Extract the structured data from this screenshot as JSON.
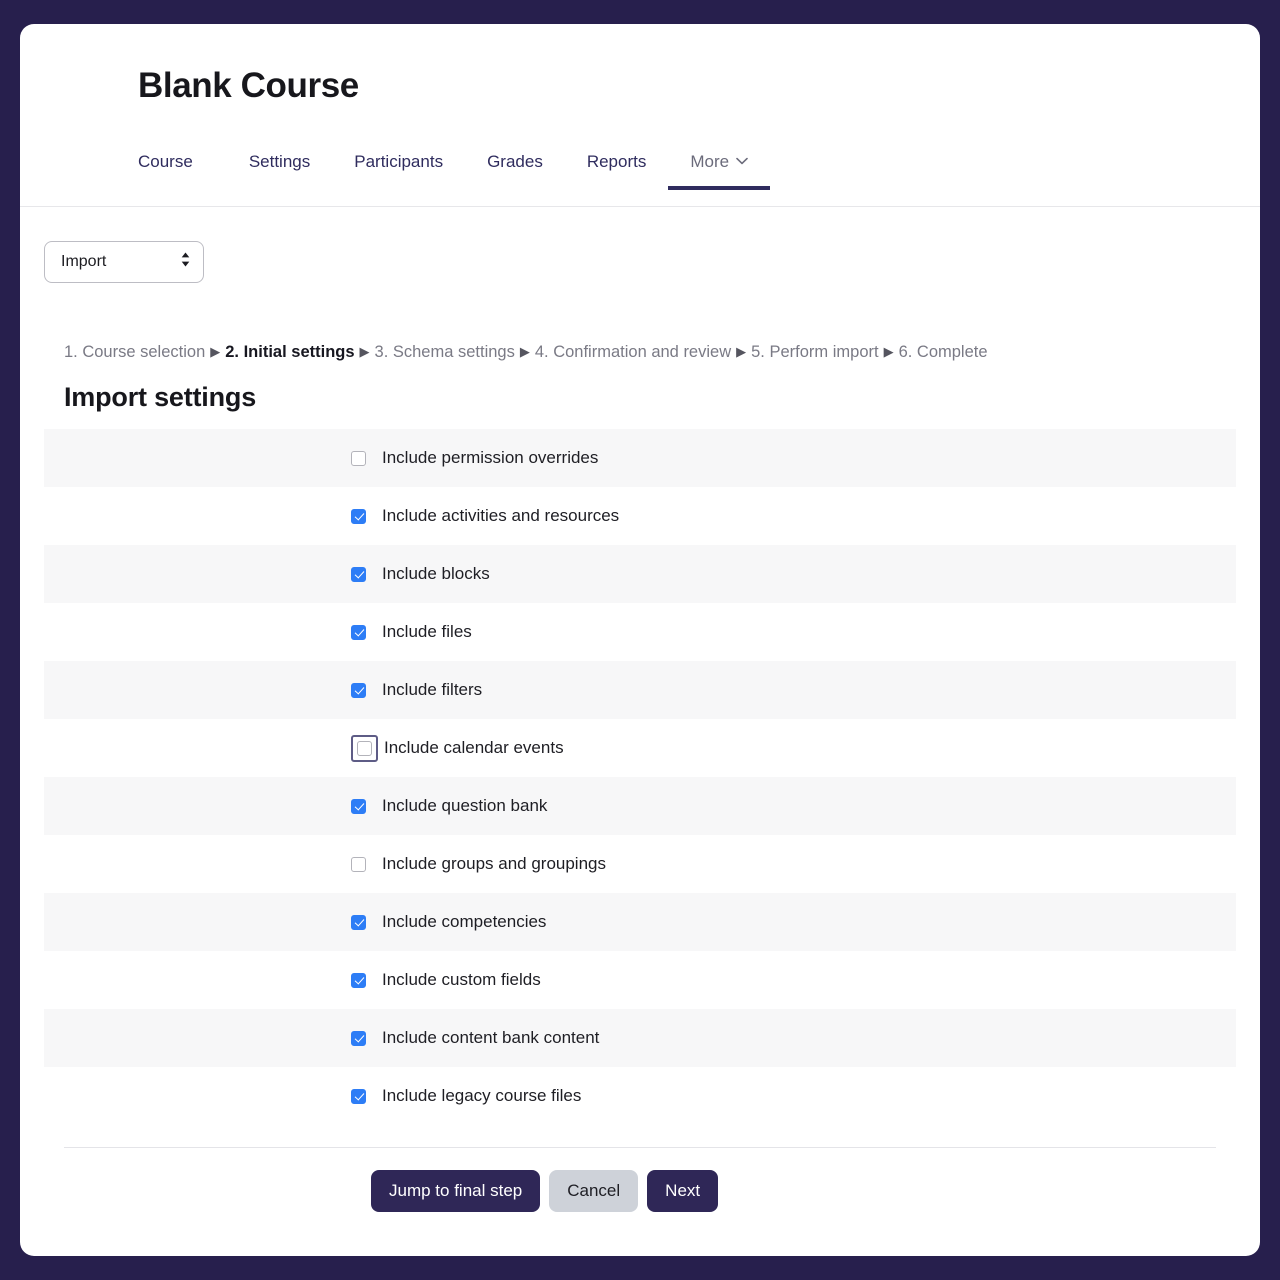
{
  "window": {
    "background_color": "#271f4d",
    "card_background": "#ffffff"
  },
  "header": {
    "course_title": "Blank Course",
    "nav_tabs": [
      {
        "label": "Course",
        "active": false
      },
      {
        "label": "Settings",
        "active": false
      },
      {
        "label": "Participants",
        "active": false
      },
      {
        "label": "Grades",
        "active": false
      },
      {
        "label": "Reports",
        "active": false
      },
      {
        "label": "More",
        "active": true,
        "has_chevron": true
      }
    ]
  },
  "action_select": {
    "value": "Import",
    "icon": "updown-arrows-icon"
  },
  "steps": {
    "items": [
      {
        "label": "1. Course selection",
        "current": false
      },
      {
        "label": "2. Initial settings",
        "current": true
      },
      {
        "label": "3. Schema settings",
        "current": false
      },
      {
        "label": "4. Confirmation and review",
        "current": false
      },
      {
        "label": "5. Perform import",
        "current": false
      },
      {
        "label": "6. Complete",
        "current": false
      }
    ],
    "separator": "▶"
  },
  "section": {
    "title": "Import settings"
  },
  "settings": {
    "accent_checked_color": "#2d7df6",
    "focus_ring_color": "#5e5c86",
    "stripe_color": "#f7f7f8",
    "rows": [
      {
        "label": "Include permission overrides",
        "checked": false,
        "striped": true,
        "focused": false
      },
      {
        "label": "Include activities and resources",
        "checked": true,
        "striped": false,
        "focused": false
      },
      {
        "label": "Include blocks",
        "checked": true,
        "striped": true,
        "focused": false
      },
      {
        "label": "Include files",
        "checked": true,
        "striped": false,
        "focused": false
      },
      {
        "label": "Include filters",
        "checked": true,
        "striped": true,
        "focused": false
      },
      {
        "label": "Include calendar events",
        "checked": false,
        "striped": false,
        "focused": true
      },
      {
        "label": "Include question bank",
        "checked": true,
        "striped": true,
        "focused": false
      },
      {
        "label": "Include groups and groupings",
        "checked": false,
        "striped": false,
        "focused": false
      },
      {
        "label": "Include competencies",
        "checked": true,
        "striped": true,
        "focused": false
      },
      {
        "label": "Include custom fields",
        "checked": true,
        "striped": false,
        "focused": false
      },
      {
        "label": "Include content bank content",
        "checked": true,
        "striped": true,
        "focused": false
      },
      {
        "label": "Include legacy course files",
        "checked": true,
        "striped": false,
        "focused": false
      }
    ]
  },
  "actions": {
    "buttons": [
      {
        "label": "Jump to final step",
        "style": "primary"
      },
      {
        "label": "Cancel",
        "style": "secondary"
      },
      {
        "label": "Next",
        "style": "primary"
      }
    ]
  }
}
